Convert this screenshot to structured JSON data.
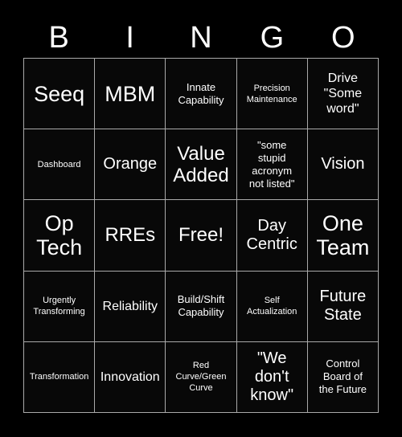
{
  "card": {
    "title_letters": [
      "B",
      "I",
      "N",
      "G",
      "O"
    ],
    "background_color": "#000000",
    "cell_background_color": "#080808",
    "grid_line_color": "#aaaaaa",
    "text_color": "#ffffff",
    "columns": 5,
    "rows": 5
  },
  "cells": [
    {
      "text": "Seeq",
      "size": "s-xl",
      "row": 1,
      "col": 1
    },
    {
      "text": "MBM",
      "size": "s-xl",
      "row": 1,
      "col": 2
    },
    {
      "text": "Innate\nCapability",
      "size": "s-xs",
      "row": 1,
      "col": 3
    },
    {
      "text": "Precision\nMaintenance",
      "size": "s-xxs",
      "row": 1,
      "col": 4
    },
    {
      "text": "Drive\n\"Some\nword\"",
      "size": "s-sm",
      "row": 1,
      "col": 5
    },
    {
      "text": "Dashboard",
      "size": "s-xxs",
      "row": 2,
      "col": 1
    },
    {
      "text": "Orange",
      "size": "s-md",
      "row": 2,
      "col": 2
    },
    {
      "text": "Value\nAdded",
      "size": "s-lg",
      "row": 2,
      "col": 3
    },
    {
      "text": "\"some\nstupid\nacronym\nnot listed\"",
      "size": "s-xs",
      "row": 2,
      "col": 4
    },
    {
      "text": "Vision",
      "size": "s-md",
      "row": 2,
      "col": 5
    },
    {
      "text": "Op\nTech",
      "size": "s-xl",
      "row": 3,
      "col": 1
    },
    {
      "text": "RREs",
      "size": "s-lg",
      "row": 3,
      "col": 2
    },
    {
      "text": "Free!",
      "size": "s-lg",
      "row": 3,
      "col": 3
    },
    {
      "text": "Day\nCentric",
      "size": "s-md",
      "row": 3,
      "col": 4
    },
    {
      "text": "One\nTeam",
      "size": "s-xl",
      "row": 3,
      "col": 5
    },
    {
      "text": "Urgently\nTransforming",
      "size": "s-xxs",
      "row": 4,
      "col": 1
    },
    {
      "text": "Reliability",
      "size": "s-sm",
      "row": 4,
      "col": 2
    },
    {
      "text": "Build/Shift\nCapability",
      "size": "s-xs",
      "row": 4,
      "col": 3
    },
    {
      "text": "Self\nActualization",
      "size": "s-xxs",
      "row": 4,
      "col": 4
    },
    {
      "text": "Future\nState",
      "size": "s-md",
      "row": 4,
      "col": 5
    },
    {
      "text": "Transformation",
      "size": "s-xxs",
      "row": 5,
      "col": 1
    },
    {
      "text": "Innovation",
      "size": "s-sm",
      "row": 5,
      "col": 2
    },
    {
      "text": "Red\nCurve/Green\nCurve",
      "size": "s-xxs",
      "row": 5,
      "col": 3
    },
    {
      "text": "\"We\ndon't\nknow\"",
      "size": "s-md",
      "row": 5,
      "col": 4
    },
    {
      "text": "Control\nBoard of\nthe Future",
      "size": "s-xs",
      "row": 5,
      "col": 5
    }
  ]
}
